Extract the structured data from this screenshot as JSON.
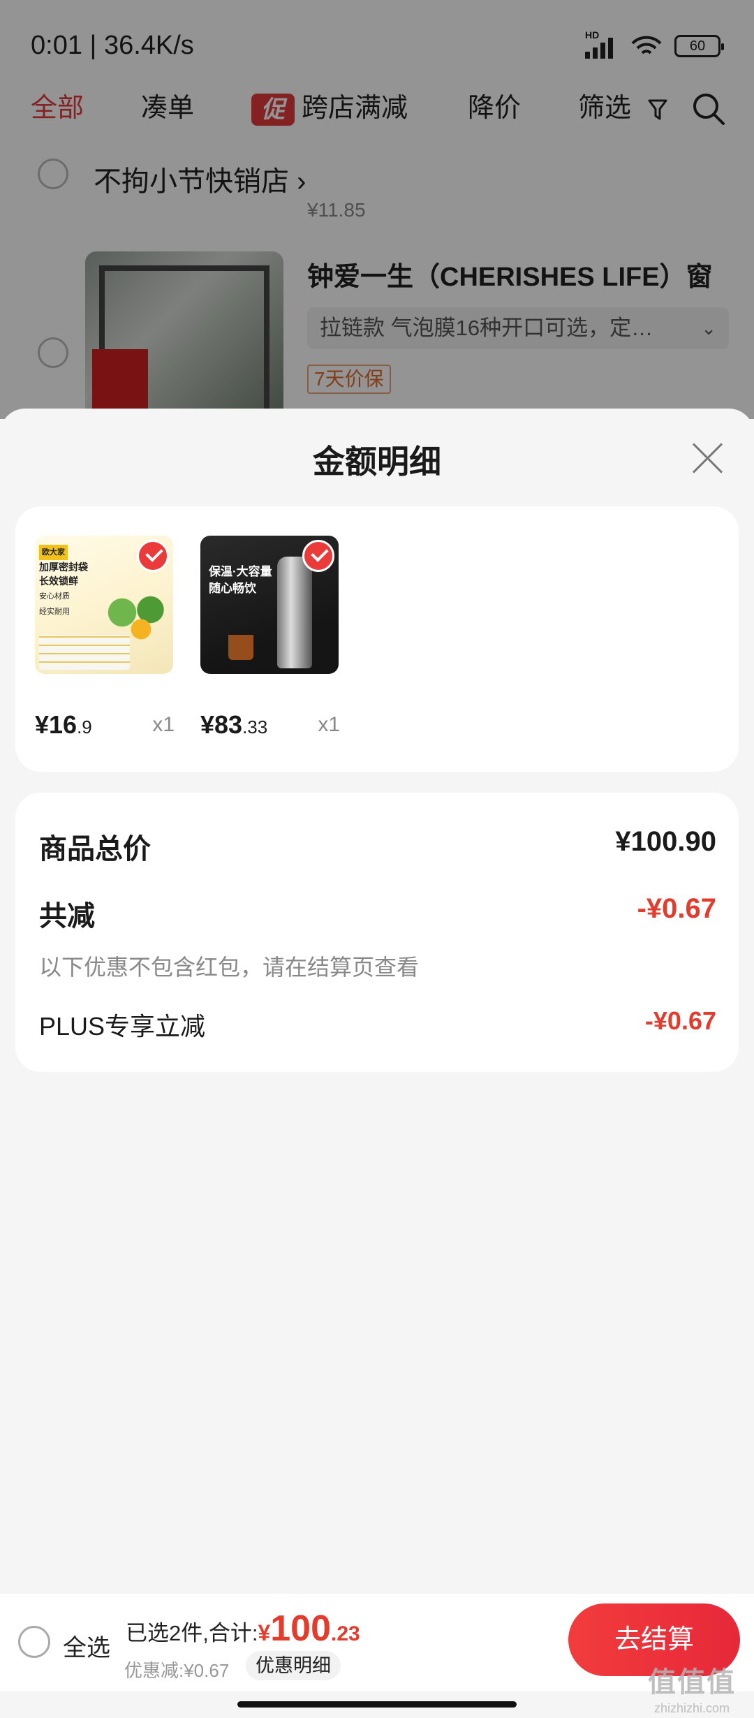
{
  "status_bar": {
    "time": "0:01 | 36.4K/s",
    "network_label": "HD",
    "battery": "60"
  },
  "tabs": {
    "all": "全部",
    "bundle": "凑单",
    "promo_badge": "促",
    "cross_store": "跨店满减",
    "price_drop": "降价",
    "filter": "筛选"
  },
  "background_cart": {
    "store_name": "不拘小节快销店",
    "prev_price": "¥11.85",
    "product_title": "钟爱一生（CHERISHES LIFE）窗",
    "spec": "拉链款 气泡膜16种开口可选，定…",
    "price_protect": "7天价保"
  },
  "sheet": {
    "title": "金额明细",
    "items": [
      {
        "currency": "¥",
        "price_int": "16",
        "price_dec": ".9",
        "qty": "x1",
        "image_text": [
          "欧大家",
          "加厚密封袋",
          "长效锁鲜",
          "安心材质",
          "经实耐用"
        ]
      },
      {
        "currency": "¥",
        "price_int": "83",
        "price_dec": ".33",
        "qty": "x1",
        "image_text": [
          "保温·大容量",
          "随心畅饮"
        ]
      }
    ],
    "summary": {
      "total_label": "商品总价",
      "total_value": "¥100.90",
      "discount_label": "共减",
      "discount_value": "-¥0.67",
      "note": "以下优惠不包含红包，请在结算页查看",
      "plus_label": "PLUS专享立减",
      "plus_value": "-¥0.67"
    }
  },
  "bottom_bar": {
    "select_all": "全选",
    "selected_text": "已选2件,合计:",
    "currency": "¥",
    "total_int": "100",
    "total_dec": ".23",
    "discount_text": "优惠减:¥0.67",
    "detail_label": "优惠明细",
    "checkout": "去结算"
  },
  "watermark": {
    "logo": "值值值",
    "site": "zhizhizhi.com"
  },
  "colors": {
    "accent": "#e4393c",
    "background": "#f5f5f5",
    "card": "#ffffff"
  }
}
